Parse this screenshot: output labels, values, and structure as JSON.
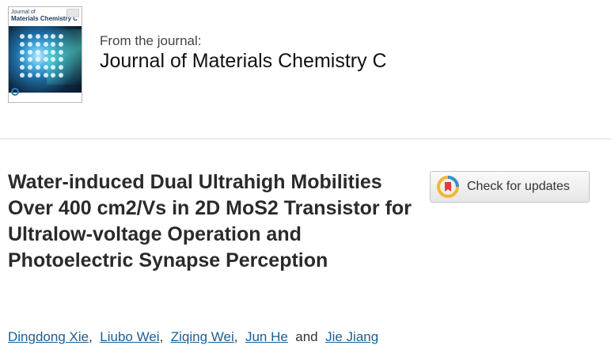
{
  "journal": {
    "cover_title_line1": "Journal of",
    "cover_title_line2": "Materials Chemistry C",
    "from_label": "From the journal:",
    "name": "Journal of Materials Chemistry C"
  },
  "article": {
    "title": "Water-induced Dual Ultrahigh Mobilities Over 400 cm2/Vs in 2D MoS2 Transistor for Ultralow-voltage Operation and Photoelectric Synapse Perception"
  },
  "updates": {
    "label": "Check for updates",
    "icon": "check-for-updates-icon"
  },
  "authors": {
    "list": [
      "Dingdong Xie",
      "Liubo Wei",
      "Ziqing Wei",
      "Jun He",
      "Jie Jiang"
    ],
    "separator": ",",
    "conjunction": "and"
  },
  "colors": {
    "link": "#1a5f94",
    "title": "#2a2a2a",
    "divider": "#d9d9d9"
  }
}
